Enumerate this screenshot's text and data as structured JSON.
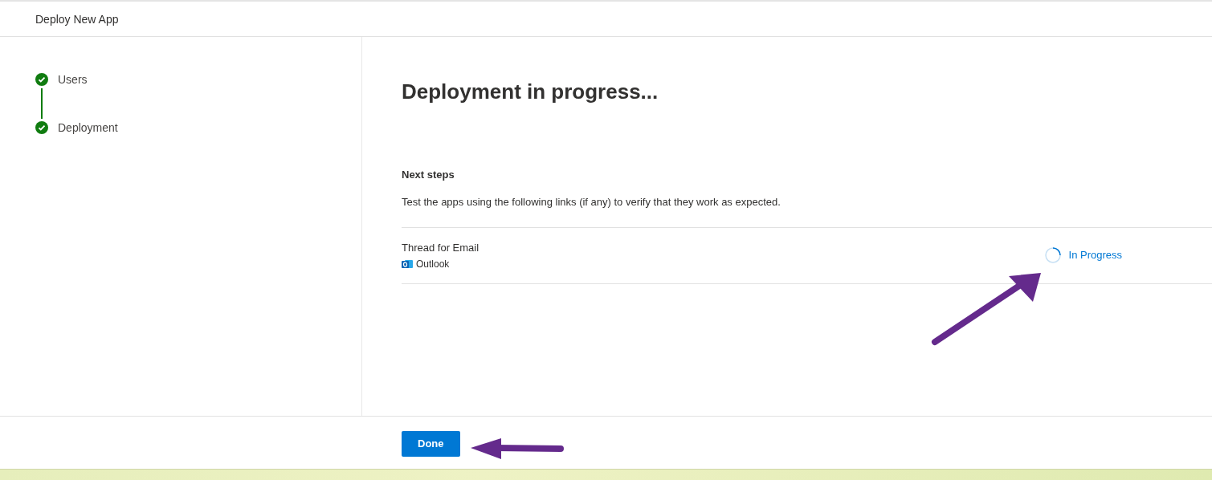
{
  "header": {
    "title": "Deploy New App"
  },
  "steps": [
    {
      "label": "Users",
      "completed": true
    },
    {
      "label": "Deployment",
      "completed": true
    }
  ],
  "main": {
    "heading": "Deployment in progress...",
    "next_steps": {
      "title": "Next steps",
      "description": "Test the apps using the following links (if any) to verify that they work as expected."
    },
    "apps": [
      {
        "name": "Thread for Email",
        "host": "Outlook",
        "status": "In Progress",
        "kind": "in_progress"
      }
    ]
  },
  "footer": {
    "buttons": [
      "Done"
    ]
  }
}
